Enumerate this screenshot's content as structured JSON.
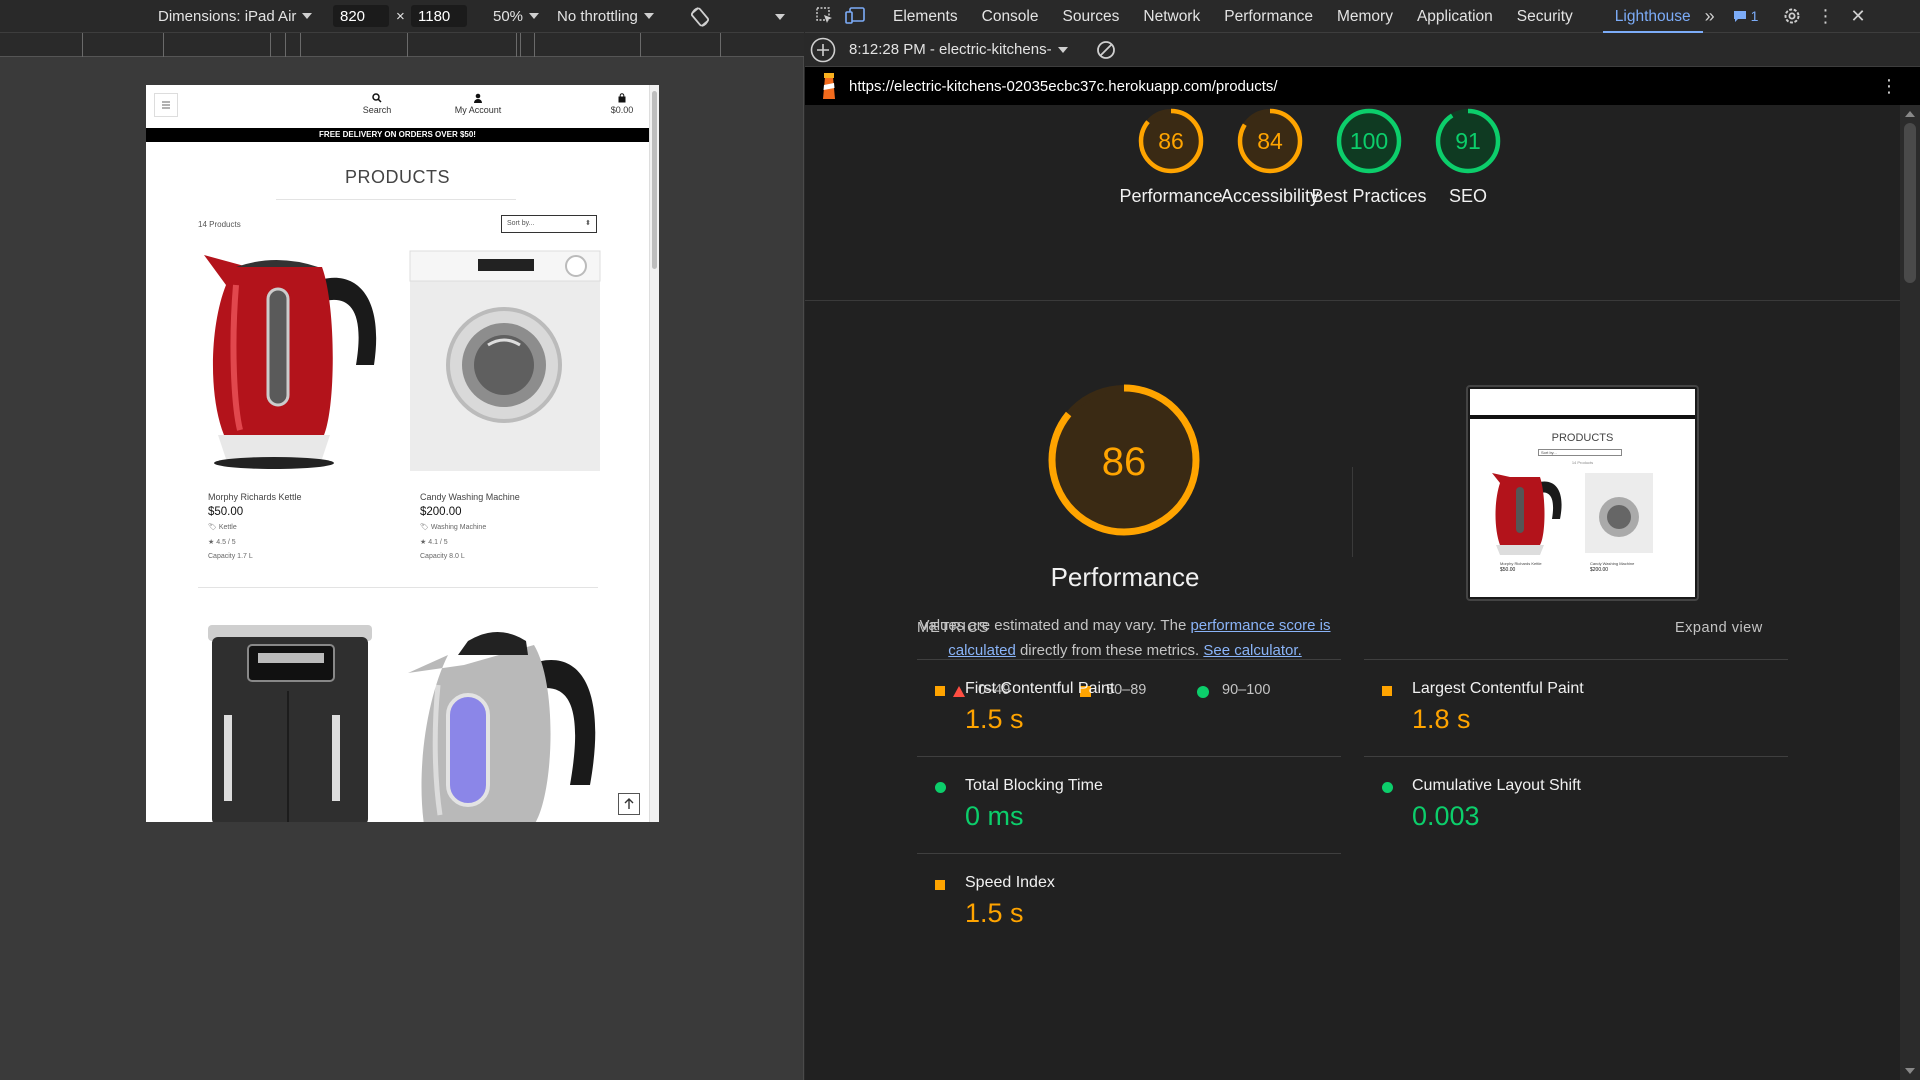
{
  "device_toolbar": {
    "dimensions_label": "Dimensions: iPad Air",
    "width": "820",
    "height": "1180",
    "times": "×",
    "zoom": "50%",
    "throttle": "No throttling"
  },
  "devtools": {
    "tabs": [
      "Elements",
      "Console",
      "Sources",
      "Network",
      "Performance",
      "Memory",
      "Application",
      "Security",
      "Lighthouse"
    ],
    "active_tab": "Lighthouse",
    "issues_count": "1",
    "timestamp": "8:12:28 PM - electric-kitchens-",
    "url": "https://electric-kitchens-02035ecbc37c.herokuapp.com/products/"
  },
  "site": {
    "nav": {
      "search": "Search",
      "account": "My Account",
      "bag": "$0.00"
    },
    "banner": "FREE DELIVERY ON ORDERS OVER $50!",
    "title": "PRODUCTS",
    "count": "14 Products",
    "sort": "Sort by...",
    "products": [
      {
        "name": "Morphy Richards Kettle",
        "price": "$50.00",
        "category": "Kettle",
        "rating": "4.5 / 5",
        "extra": "Capacity 1.7 L"
      },
      {
        "name": "Candy Washing Machine",
        "price": "$200.00",
        "category": "Washing Machine",
        "rating": "4.1 / 5",
        "extra": "Capacity 8.0 L"
      }
    ]
  },
  "scores": [
    {
      "label": "Performance",
      "value": 86,
      "color": "#ffa400"
    },
    {
      "label": "Accessibility",
      "value": 84,
      "color": "#ffa400"
    },
    {
      "label": "Best Practices",
      "value": 100,
      "color": "#0cce6b"
    },
    {
      "label": "SEO",
      "value": 91,
      "color": "#0cce6b"
    }
  ],
  "perf": {
    "score": 86,
    "title": "Performance",
    "note_a": "Values are estimated and may vary. The ",
    "link1": "performance score is calculated",
    "note_b": " directly from these metrics. ",
    "link2": "See calculator.",
    "legend": [
      "0–49",
      "50–89",
      "90–100"
    ]
  },
  "thumb": {
    "title": "PRODUCTS",
    "sort": "Sort by...",
    "count": "14 Products",
    "p1": "Morphy Richards Kettle",
    "p1price": "$50.00",
    "p2": "Candy Washing Machine",
    "p2price": "$200.00"
  },
  "metrics": {
    "heading": "METRICS",
    "expand": "Expand view",
    "items": [
      {
        "name": "First Contentful Paint",
        "value": "1.5 s",
        "status": "average"
      },
      {
        "name": "Largest Contentful Paint",
        "value": "1.8 s",
        "status": "average"
      },
      {
        "name": "Total Blocking Time",
        "value": "0 ms",
        "status": "pass"
      },
      {
        "name": "Cumulative Layout Shift",
        "value": "0.003",
        "status": "pass"
      },
      {
        "name": "Speed Index",
        "value": "1.5 s",
        "status": "average"
      }
    ]
  }
}
